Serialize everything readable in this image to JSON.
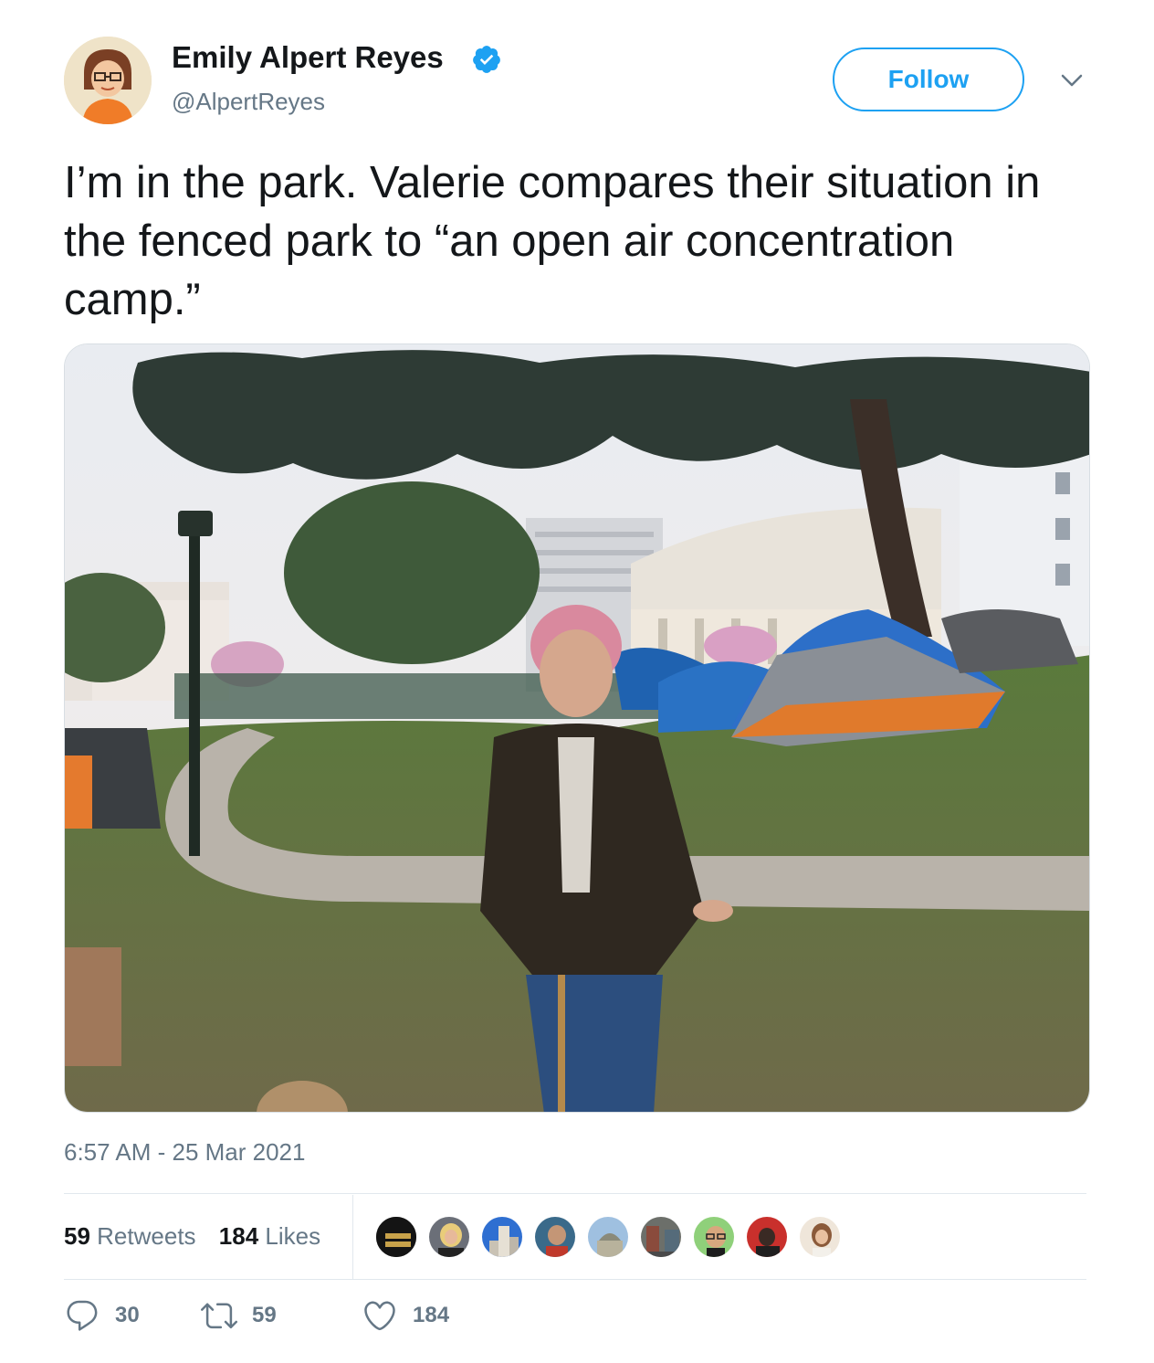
{
  "author": {
    "name": "Emily Alpert Reyes",
    "handle": "@AlpertReyes",
    "verified": true,
    "avatar_icon": "pixel-art-avatar"
  },
  "follow_label": "Follow",
  "menu_icon": "chevron-down-icon",
  "tweet": {
    "text": "I’m in the park. Valerie compares their situation in the fenced park to “an open air concentration camp.”",
    "image_icon": "park-photo",
    "timestamp": "6:57 AM - 25 Mar 2021"
  },
  "stats": {
    "retweets_count": "59",
    "retweets_label": "Retweets",
    "likes_count": "184",
    "likes_label": "Likes"
  },
  "likers": [
    {
      "icon": "para-nadie-avatar"
    },
    {
      "icon": "blonde-woman-avatar"
    },
    {
      "icon": "city-building-avatar"
    },
    {
      "icon": "man-avatar"
    },
    {
      "icon": "dome-building-avatar"
    },
    {
      "icon": "street-scene-avatar"
    },
    {
      "icon": "person-glasses-avatar"
    },
    {
      "icon": "red-background-avatar"
    },
    {
      "icon": "woman-portrait-avatar"
    }
  ],
  "actions": {
    "reply_count": "30",
    "retweet_count": "59",
    "like_count": "184"
  },
  "colors": {
    "accent": "#1da1f2",
    "secondary_text": "#657786",
    "primary_text": "#14171a",
    "divider": "#e1e8ed"
  }
}
